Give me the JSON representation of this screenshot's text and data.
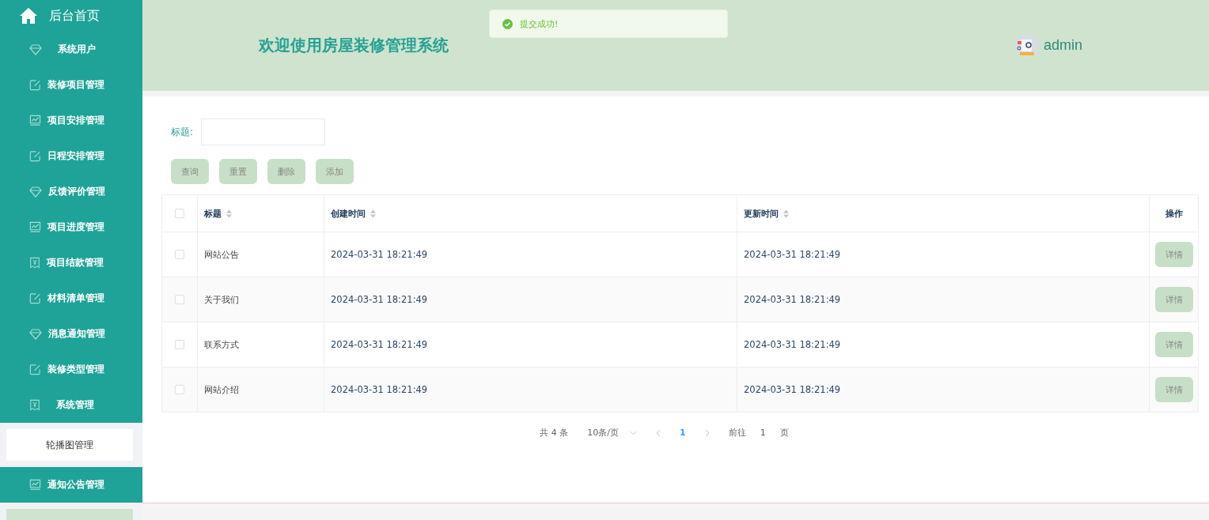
{
  "sidebar": {
    "home": {
      "label": "后台首页"
    },
    "items": [
      {
        "label": "系统用户",
        "kind": "diamond"
      },
      {
        "label": "装修项目管理",
        "kind": "edit"
      },
      {
        "label": "项目安排管理",
        "kind": "chart"
      },
      {
        "label": "日程安排管理",
        "kind": "edit"
      },
      {
        "label": "反馈评价管理",
        "kind": "diamond"
      },
      {
        "label": "项目进度管理",
        "kind": "chart"
      },
      {
        "label": "项目结款管理",
        "kind": "receipt"
      },
      {
        "label": "材料清单管理",
        "kind": "edit"
      },
      {
        "label": "消息通知管理",
        "kind": "diamond"
      },
      {
        "label": "装修类型管理",
        "kind": "edit"
      },
      {
        "label": "系统管理",
        "kind": "receipt",
        "expanded": true,
        "children": [
          {
            "label": "轮播图管理"
          }
        ]
      },
      {
        "label": "通知公告管理",
        "kind": "chart"
      }
    ]
  },
  "header": {
    "title": "欢迎使用房屋装修管理系统",
    "user": "admin"
  },
  "toast": {
    "message": "提交成功!"
  },
  "search": {
    "label": "标题:"
  },
  "buttons": [
    "查询",
    "重置",
    "删除",
    "添加"
  ],
  "table": {
    "columns": [
      {
        "label": "标题",
        "sortable": true
      },
      {
        "label": "创建时间",
        "sortable": true
      },
      {
        "label": "更新时间",
        "sortable": true
      },
      {
        "label": "操作",
        "sortable": false
      }
    ],
    "header_checked": false,
    "rows": [
      {
        "checked": false,
        "title": "网站公告",
        "created": "2024-03-31 18:21:49",
        "updated": "2024-03-31 18:21:49",
        "action": "详情"
      },
      {
        "checked": false,
        "title": "关于我们",
        "created": "2024-03-31 18:21:49",
        "updated": "2024-03-31 18:21:49",
        "action": "详情"
      },
      {
        "checked": false,
        "title": "联系方式",
        "created": "2024-03-31 18:21:49",
        "updated": "2024-03-31 18:21:49",
        "action": "详情"
      },
      {
        "checked": false,
        "title": "网站介绍",
        "created": "2024-03-31 18:21:49",
        "updated": "2024-03-31 18:21:49",
        "action": "详情"
      }
    ]
  },
  "pagination": {
    "total": "共 4 条",
    "page_size": "10条/页",
    "pages": [
      {
        "label": "1",
        "selected": true
      }
    ],
    "goto_label": "前往",
    "goto_value": "1",
    "goto_suffix": "页"
  }
}
